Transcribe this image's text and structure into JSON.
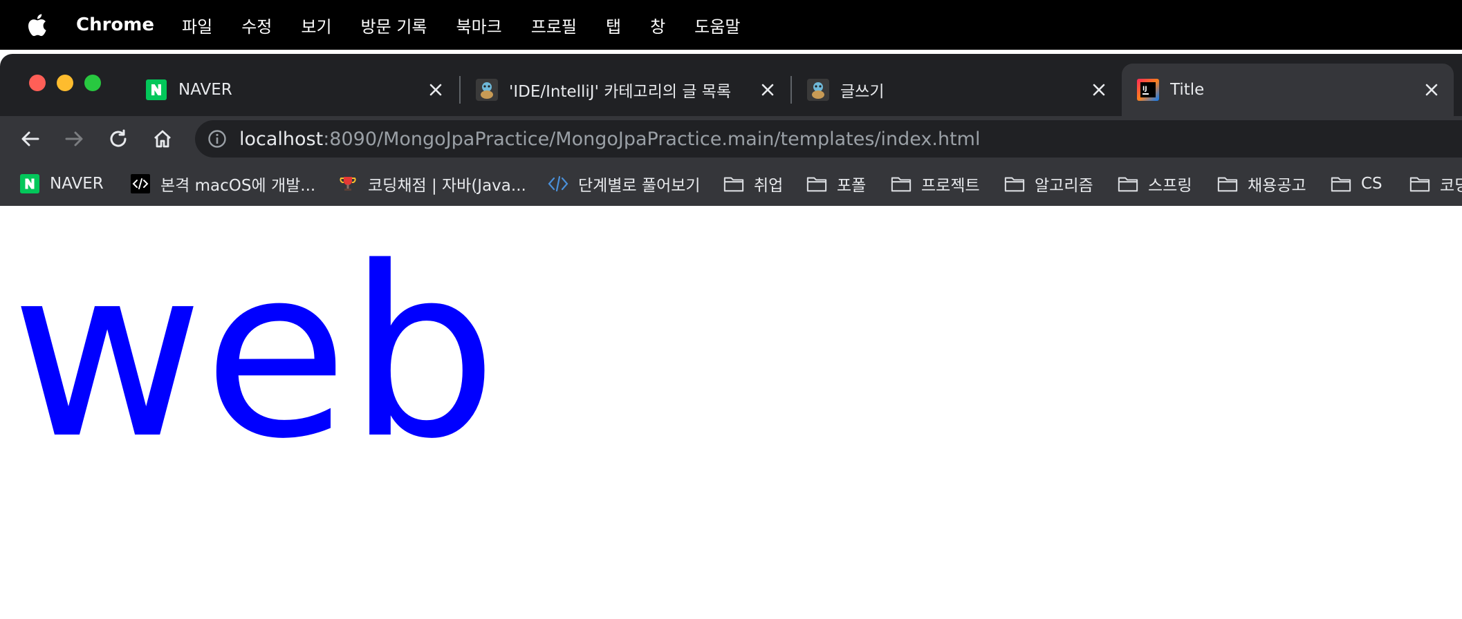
{
  "menubar": {
    "apple_icon": "apple-logo-icon",
    "app_name": "Chrome",
    "items": [
      "파일",
      "수정",
      "보기",
      "방문 기록",
      "북마크",
      "프로필",
      "탭",
      "창",
      "도움말"
    ]
  },
  "tabs": [
    {
      "title": "NAVER",
      "icon": "naver-n-icon",
      "active": false
    },
    {
      "title": "'IDE/IntelliJ' 카테고리의 글 목록",
      "icon": "squirtle-favicon-icon",
      "active": false
    },
    {
      "title": "글쓰기",
      "icon": "squirtle-favicon-icon",
      "active": false
    },
    {
      "title": "Title",
      "icon": "intellij-icon",
      "active": true
    }
  ],
  "address_bar": {
    "host": "localhost",
    "rest": ":8090/MongoJpaPractice/MongoJpaPractice.main/templates/index.html"
  },
  "bookmarks": [
    {
      "label": "NAVER",
      "icon": "naver-n-icon"
    },
    {
      "label": "본격 macOS에 개발...",
      "icon": "code-icon"
    },
    {
      "label": "코딩채점 | 자바(Java...",
      "icon": "trophy-icon"
    },
    {
      "label": "단계별로 풀어보기",
      "icon": "brackets-icon"
    },
    {
      "label": "취업",
      "icon": "folder-icon"
    },
    {
      "label": "포폴",
      "icon": "folder-icon"
    },
    {
      "label": "프로젝트",
      "icon": "folder-icon"
    },
    {
      "label": "알고리즘",
      "icon": "folder-icon"
    },
    {
      "label": "스프링",
      "icon": "folder-icon"
    },
    {
      "label": "채용공고",
      "icon": "folder-icon"
    },
    {
      "label": "CS",
      "icon": "folder-icon"
    },
    {
      "label": "코딩",
      "icon": "folder-icon"
    }
  ],
  "page": {
    "heading": "web",
    "heading_color": "#0000ff"
  },
  "colors": {
    "menubar_bg": "#000000",
    "tabstrip_bg": "#202124",
    "toolbar_bg": "#35363a",
    "page_bg": "#ffffff"
  }
}
